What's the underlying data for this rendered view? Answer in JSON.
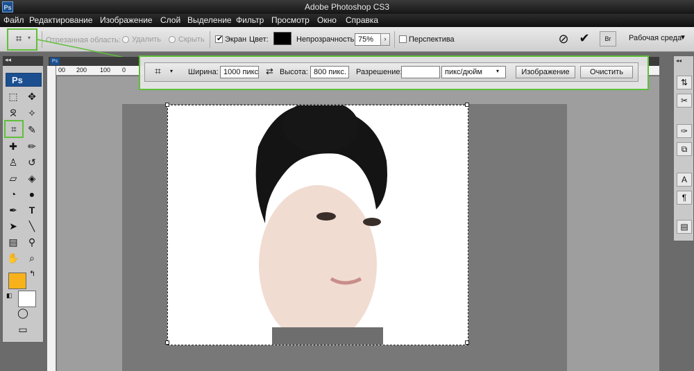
{
  "app": {
    "title": "Adobe Photoshop CS3",
    "logo": "Ps"
  },
  "menu": [
    "Файл",
    "Редактирование",
    "Изображение",
    "Слой",
    "Выделение",
    "Фильтр",
    "Просмотр",
    "Окно",
    "Справка"
  ],
  "options_bar": {
    "cropped_area_label": "Отрезанная область:",
    "delete_label": "Удалить",
    "hide_label": "Скрыть",
    "screen_label": "Экран",
    "screen_checked": true,
    "color_label": "Цвет:",
    "color_value": "#000000",
    "opacity_label": "Непрозрачность:",
    "opacity_value": "75%",
    "perspective_label": "Перспектива",
    "workspace_label": "Рабочая среда",
    "cancel_icon": "cancel-icon",
    "commit_icon": "checkmark-icon",
    "bridge_icon": "bridge-icon"
  },
  "crop_options": {
    "width_label": "Ширина:",
    "width_value": "1000 пикс",
    "height_label": "Высота:",
    "height_value": "800 пикс.",
    "resolution_label": "Разрешение:",
    "resolution_value": "",
    "unit_value": "пикс/дюйм",
    "image_button": "Изображение",
    "clear_button": "Очистить"
  },
  "ruler": {
    "h_ticks": [
      "00",
      "200",
      "100",
      "0"
    ]
  },
  "toolbox": {
    "logo": "Ps",
    "foreground_color": "#f7b21b",
    "background_color": "#ffffff",
    "tools": [
      "marquee-icon",
      "move-icon",
      "lasso-icon",
      "magic-wand-icon",
      "crop-icon",
      "slice-icon",
      "healing-brush-icon",
      "brush-icon",
      "clone-stamp-icon",
      "history-brush-icon",
      "eraser-icon",
      "paint-bucket-icon",
      "blur-icon",
      "dodge-icon",
      "pen-icon",
      "type-icon",
      "path-selection-icon",
      "line-icon",
      "notes-icon",
      "eyedropper-icon",
      "hand-icon",
      "zoom-icon"
    ]
  },
  "doc_tab": {
    "label": "Ps"
  },
  "accent": {
    "highlight_green": "#5fbf3a"
  }
}
